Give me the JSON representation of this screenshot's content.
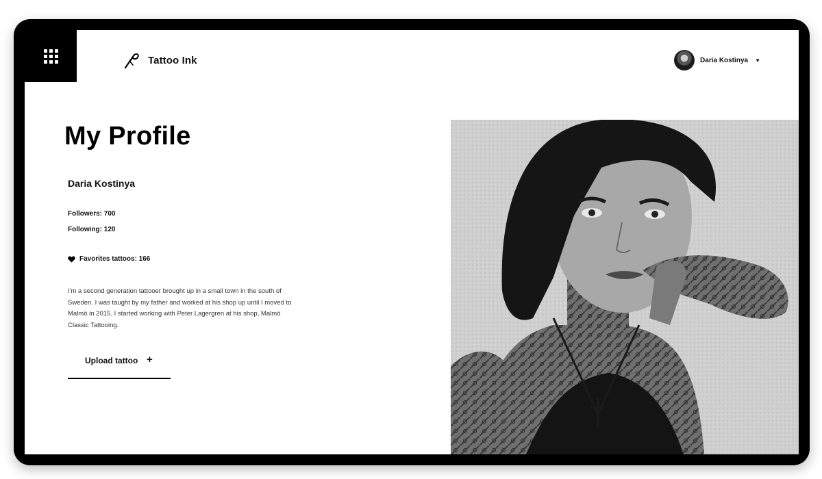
{
  "app": {
    "name": "Tattoo Ink"
  },
  "header": {
    "menu_icon": "grid-icon",
    "logo_icon": "needle-icon",
    "user": {
      "name": "Daria Kostinya",
      "dropdown_icon": "caret-down-icon"
    }
  },
  "profile": {
    "page_title": "My Profile",
    "name": "Daria Kostinya",
    "followers": "Followers: 700",
    "following": "Following: 120",
    "favorites": "Favorites tattoos: 166",
    "favorites_icon": "heart-icon",
    "bio": "I'm a second generation tattooer brought up in a small town in the south of Sweden. I was taught by my father and worked at his shop up until I moved to Malmö in 2015. I started working with Peter Lagergren at his shop, Malmö Classic Tattooing.",
    "upload_label": "Upload tattoo",
    "upload_icon": "plus-icon"
  },
  "colors": {
    "primary": "#000000",
    "background": "#ffffff",
    "text": "#111111"
  }
}
